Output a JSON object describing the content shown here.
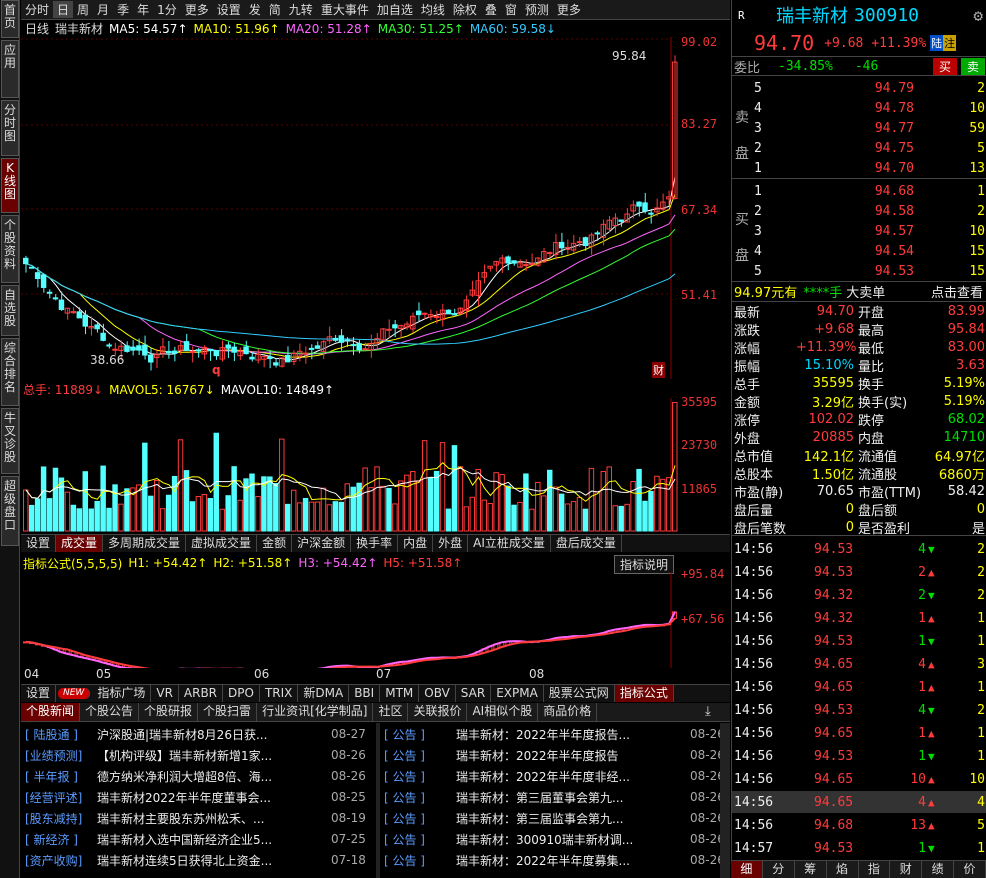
{
  "sidebar": [
    "首页",
    "应用",
    "分时图",
    "K线图",
    "个股资料",
    "自选股",
    "综合排名",
    "牛叉诊股",
    "超级盘口"
  ],
  "topbar": [
    "分时",
    "日",
    "周",
    "月",
    "季",
    "年",
    "1分",
    "更多",
    "设置",
    "发",
    "简",
    "九转",
    "重大事件",
    "加自选",
    "均线",
    "除权",
    "叠",
    "窗",
    "预测",
    "更多"
  ],
  "ma_legend": [
    {
      "text": "日线",
      "color": "#dddddd"
    },
    {
      "text": "瑞丰新材",
      "color": "#dddddd"
    },
    {
      "text": "MA5: 54.57↑",
      "color": "#ffffff"
    },
    {
      "text": "MA10: 51.96↑",
      "color": "#ffff00"
    },
    {
      "text": "MA20: 51.28↑",
      "color": "#ff66ff"
    },
    {
      "text": "MA30: 51.25↑",
      "color": "#33ff33"
    },
    {
      "text": "MA60: 59.58↓",
      "color": "#33ccff"
    }
  ],
  "kline_axis": [
    "99.02",
    "83.27",
    "67.34",
    "51.41"
  ],
  "kline_marks": {
    "high": "95.84",
    "low": "38.66",
    "q": "q",
    "cai": "财"
  },
  "vol_legend": [
    {
      "text": "总手: 11889↓",
      "color": "#ff3c3c"
    },
    {
      "text": "MAVOL5: 16767↓",
      "color": "#ffff00"
    },
    {
      "text": "MAVOL10: 14849↑",
      "color": "#ffffff"
    }
  ],
  "vol_axis": [
    "35595",
    "23730",
    "11865"
  ],
  "tabs1": [
    "设置",
    "成交量",
    "多周期成交量",
    "虚拟成交量",
    "金额",
    "沪深金额",
    "换手率",
    "内盘",
    "外盘",
    "AI立桩成交量",
    "盘后成交量"
  ],
  "ind_legend": [
    {
      "text": "指标公式(5,5,5,5)",
      "color": "#ffff00"
    },
    {
      "text": "H1: +54.42↑",
      "color": "#ffff00"
    },
    {
      "text": "H2: +51.58↑",
      "color": "#ffff00"
    },
    {
      "text": "H3: +54.42↑",
      "color": "#ff66ff"
    },
    {
      "text": "H5: +51.58↑",
      "color": "#ff3c3c"
    }
  ],
  "ind_button": "指标说明",
  "ind_axis": [
    "+95.84",
    "+67.56"
  ],
  "date_axis": [
    "04",
    "05",
    "06",
    "07",
    "08"
  ],
  "tabs2": [
    "设置",
    "NEW",
    "指标广场",
    "VR",
    "ARBR",
    "DPO",
    "TRIX",
    "新DMA",
    "BBI",
    "MTM",
    "OBV",
    "SAR",
    "EXPMA",
    "股票公式网",
    "指标公式"
  ],
  "newstabs": [
    "个股新闻",
    "个股公告",
    "个股研报",
    "个股扫雷",
    "行业资讯[化学制品]",
    "社区",
    "关联报价",
    "AI相似个股",
    "商品价格"
  ],
  "news_left": [
    {
      "tag": "[ 陆股通 ]",
      "title": "沪深股通|瑞丰新材8月26日获...",
      "date": "08-27"
    },
    {
      "tag": "[业绩预测]",
      "title": "【机构评级】瑞丰新材新增1家...",
      "date": "08-26"
    },
    {
      "tag": "[ 半年报 ]",
      "title": "德方纳米净利润大增超8倍、海...",
      "date": "08-26"
    },
    {
      "tag": "[经营评述]",
      "title": "瑞丰新材2022年半年度董事会...",
      "date": "08-25"
    },
    {
      "tag": "[股东减持]",
      "title": "瑞丰新材主要股东苏州松禾、...",
      "date": "08-19"
    },
    {
      "tag": "[ 新经济 ]",
      "title": "瑞丰新材入选中国新经济企业5...",
      "date": "07-25"
    },
    {
      "tag": "[资产收购]",
      "title": "瑞丰新材连续5日获得北上资金...",
      "date": "07-18"
    }
  ],
  "news_right": [
    {
      "tag": "[  公告  ]",
      "title": "瑞丰新材：2022年半年度报告...",
      "date": "08-26"
    },
    {
      "tag": "[  公告  ]",
      "title": "瑞丰新材：2022年半年度报告",
      "date": "08-26"
    },
    {
      "tag": "[  公告  ]",
      "title": "瑞丰新材：2022年半年度非经...",
      "date": "08-26"
    },
    {
      "tag": "[  公告  ]",
      "title": "瑞丰新材：第三届董事会第九...",
      "date": "08-26"
    },
    {
      "tag": "[  公告  ]",
      "title": "瑞丰新材：第三届监事会第九...",
      "date": "08-26"
    },
    {
      "tag": "[  公告  ]",
      "title": "瑞丰新材：300910瑞丰新材调...",
      "date": "08-26"
    },
    {
      "tag": "[  公告  ]",
      "title": "瑞丰新材：2022年半年度募集...",
      "date": "08-26"
    }
  ],
  "quote": {
    "r": "R",
    "name": "瑞丰新材",
    "code": "300910",
    "price": "94.70",
    "chg": "+9.68",
    "pct": "+11.39%",
    "tag1": "陆",
    "tag2": "注",
    "weibi_label": "委比",
    "weibi": "-34.85%",
    "weicha": "-46",
    "buy": "买",
    "sell": "卖"
  },
  "asks": [
    [
      "5",
      "94.79",
      "2"
    ],
    [
      "4",
      "94.78",
      "10"
    ],
    [
      "3",
      "94.77",
      "59"
    ],
    [
      "2",
      "94.75",
      "5"
    ],
    [
      "1",
      "94.70",
      "13"
    ]
  ],
  "bids": [
    [
      "1",
      "94.68",
      "1"
    ],
    [
      "2",
      "94.58",
      "2"
    ],
    [
      "3",
      "94.57",
      "10"
    ],
    [
      "4",
      "94.54",
      "15"
    ],
    [
      "5",
      "94.53",
      "15"
    ]
  ],
  "ask_label": [
    "卖",
    "盘"
  ],
  "bid_label": [
    "买",
    "盘"
  ],
  "bigorder": {
    "price": "94.97元有",
    "mid": "****手",
    "big": "大卖单",
    "link": "点击查看"
  },
  "stats": [
    [
      "最新",
      "94.70",
      "red",
      "开盘",
      "83.99",
      "red"
    ],
    [
      "涨跌",
      "+9.68",
      "red",
      "最高",
      "95.84",
      "red"
    ],
    [
      "涨幅",
      "+11.39%",
      "red",
      "最低",
      "83.00",
      "red"
    ],
    [
      "振幅",
      "15.10%",
      "cyan",
      "量比",
      "3.63",
      "red"
    ],
    [
      "总手",
      "35595",
      "yel",
      "换手",
      "5.19%",
      "yel"
    ],
    [
      "金额",
      "3.29亿",
      "yel",
      "换手(实)",
      "5.19%",
      "yel"
    ],
    [
      "涨停",
      "102.02",
      "red",
      "跌停",
      "68.02",
      "green"
    ],
    [
      "外盘",
      "20885",
      "red",
      "内盘",
      "14710",
      "green"
    ],
    [
      "总市值",
      "142.1亿",
      "yel",
      "流通值",
      "64.97亿",
      "yel"
    ],
    [
      "总股本",
      "1.50亿",
      "yel",
      "流通股",
      "6860万",
      "yel"
    ],
    [
      "市盈(静)",
      "70.65",
      "wht",
      "市盈(TTM)",
      "58.42",
      "wht"
    ],
    [
      "盘后量",
      "0",
      "yel",
      "盘后额",
      "0",
      "yel"
    ],
    [
      "盘后笔数",
      "0",
      "yel",
      "是否盈利",
      "是",
      "wht"
    ]
  ],
  "ticks": [
    [
      "14:56",
      "94.53",
      "4",
      "down",
      "2"
    ],
    [
      "14:56",
      "94.53",
      "2",
      "up",
      "2"
    ],
    [
      "14:56",
      "94.32",
      "2",
      "down",
      "2"
    ],
    [
      "14:56",
      "94.32",
      "1",
      "up",
      "1"
    ],
    [
      "14:56",
      "94.53",
      "1",
      "down",
      "1"
    ],
    [
      "14:56",
      "94.65",
      "4",
      "up",
      "3"
    ],
    [
      "14:56",
      "94.65",
      "1",
      "up",
      "1"
    ],
    [
      "14:56",
      "94.53",
      "4",
      "down",
      "2"
    ],
    [
      "14:56",
      "94.65",
      "1",
      "up",
      "1"
    ],
    [
      "14:56",
      "94.53",
      "1",
      "down",
      "1"
    ],
    [
      "14:56",
      "94.65",
      "10",
      "up",
      "10"
    ],
    [
      "14:56",
      "94.65",
      "4",
      "up",
      "4"
    ],
    [
      "14:56",
      "94.68",
      "13",
      "up",
      "5"
    ],
    [
      "14:57",
      "94.53",
      "1",
      "down",
      "1"
    ]
  ],
  "bottomtabs": [
    "细",
    "分",
    "筹",
    "焰",
    "指",
    "财",
    "绩",
    "价"
  ]
}
